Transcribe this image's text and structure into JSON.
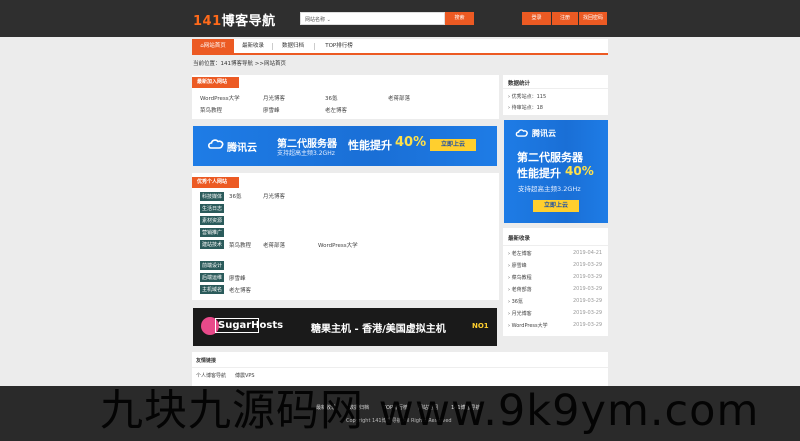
{
  "header": {
    "logo_num": "141",
    "logo_text": "博客导航",
    "search_placeholder": "网站名称 ⌄",
    "search_button": "搜索",
    "login": "登录",
    "register": "注册",
    "forgot": "找回密码"
  },
  "nav": {
    "items": [
      {
        "label": "⌂网站首页",
        "active": true
      },
      {
        "label": "最新收录",
        "active": false
      },
      {
        "label": "数据归档",
        "active": false
      },
      {
        "label": "TOP排行榜",
        "active": false
      }
    ]
  },
  "breadcrumb": "当前位置：141博客导航  >>网站首页",
  "latest": {
    "title": "最新加入网站",
    "row1": [
      "WordPress大学",
      "月光博客",
      "36氪",
      "老蒋部落"
    ],
    "row2": [
      "菜鸟教程",
      "廖雪峰",
      "老左博客"
    ]
  },
  "ad_tencent": {
    "brand": "腾讯云",
    "headline": "第二代服务器",
    "subline": "支持超高主频3.2GHz",
    "perf": "性能提升",
    "perf_num": "40%",
    "button": "立即上云"
  },
  "personal": {
    "title": "优秀个人网站",
    "groups": [
      {
        "tag": "科技媒体",
        "sites": [
          "36氪",
          "月光博客"
        ]
      },
      {
        "tag": "生活日志",
        "sites": []
      },
      {
        "tag": "素材资源",
        "sites": []
      },
      {
        "tag": "营销推广",
        "sites": []
      },
      {
        "tag": "建站技术",
        "sites": [
          "菜鸟教程",
          "老蒋部落",
          "WordPress大学"
        ]
      },
      {
        "tag": "前端设计",
        "sites": []
      },
      {
        "tag": "后端运维",
        "sites": [
          "廖雪峰"
        ]
      },
      {
        "tag": "主机域名",
        "sites": [
          "老左博客"
        ]
      }
    ]
  },
  "ad_sugar": {
    "brand": "SugarHosts",
    "text": "糖果主机 - 香港/美国虚拟主机",
    "badge": "NO1"
  },
  "links": {
    "title": "友情链接",
    "items": [
      "个人博客导航",
      "傅震VPS"
    ]
  },
  "stats": {
    "title": "数据统计",
    "lines": [
      "优秀站点：115",
      "待审站点：18"
    ]
  },
  "ad_side": {
    "brand": "腾讯云",
    "headline": "第二代服务器",
    "perf": "性能提升",
    "perf_num": "40%",
    "subline": "支持超高主频3.2GHz",
    "button": "立即上云"
  },
  "recent": {
    "title": "最新收录",
    "items": [
      {
        "name": "老左博客",
        "date": "2019-04-21"
      },
      {
        "name": "廖雪峰",
        "date": "2019-03-29"
      },
      {
        "name": "菜鸟教程",
        "date": "2019-03-29"
      },
      {
        "name": "老蒋部落",
        "date": "2019-03-29"
      },
      {
        "name": "36氪",
        "date": "2019-03-29"
      },
      {
        "name": "月光博客",
        "date": "2019-03-29"
      },
      {
        "name": "WordPress大学",
        "date": "2019-03-29"
      }
    ]
  },
  "footer": {
    "links": [
      "最新收录",
      "数据归档",
      "TOP排行榜",
      "网站地图",
      "141博客导航"
    ],
    "copyright": "Copyright 141博客导航 All Rights Reserved"
  },
  "watermark": "九块九源码网 www.9k9ym.com"
}
